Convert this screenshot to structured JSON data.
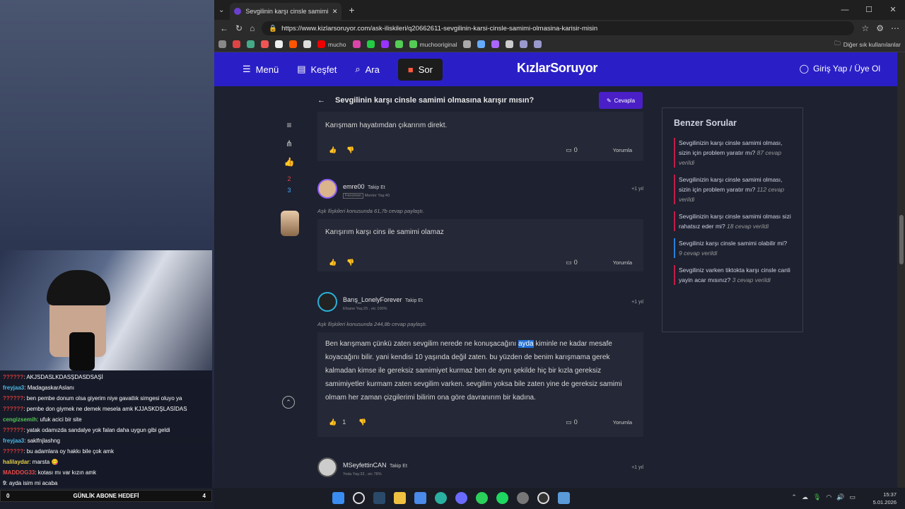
{
  "stream": {
    "chat": [
      {
        "user": "??????",
        "text": ": AKJSDASLKDASŞDASDSAŞİ",
        "color": "#d43a3a"
      },
      {
        "user": "freyjaa3",
        "text": ": MadagaskarAslanı",
        "color": "#4ab8e8"
      },
      {
        "user": "??????",
        "text": ": ben pembe donum olsa giyerim niye gavatlık simgesi oluyo ya",
        "color": "#d43a3a"
      },
      {
        "user": "??????",
        "text": ": pembe don giymek ne demek mesela amk KJJASKDŞLASİDAS",
        "color": "#d43a3a"
      },
      {
        "user": "cengizsemih",
        "text": ": ufuk acici bir site",
        "color": "#56c456"
      },
      {
        "user": "??????",
        "text": ": yatak odamızda sandalye yok falan daha uygun gibi geldi",
        "color": "#d43a3a"
      },
      {
        "user": "freyjaa3",
        "text": ": saklfnjlashng",
        "color": "#4ab8e8"
      },
      {
        "user": "??????",
        "text": ": bu adamlara oy hakkı bile çok amk",
        "color": "#d43a3a"
      },
      {
        "user": "halilaydar",
        "text": ": marsta 😋",
        "color": "#e8d04a"
      },
      {
        "user": "MADDOG33",
        "text": ": kotası mı var kızın amk",
        "color": "#e84a4a"
      },
      {
        "user": "9",
        "text": ": ayda isim mi acaba",
        "color": "#dddddd"
      }
    ],
    "goal_label": "GÜNLİK ABONE HEDEFİ",
    "goal_left": "0",
    "goal_right": "4"
  },
  "browser": {
    "tab_title": "Sevgilinin karşı cinsle samimi olma",
    "url": "https://www.kizlarsoruyor.com/ask-iliskileri/q20662611-sevgilinin-karsi-cinsle-samimi-olmasina-karisir-misin",
    "bookmarks": [
      "mucho",
      "muchooriginal"
    ],
    "bookmark_folder": "Diğer sık kullanılanlar"
  },
  "site": {
    "nav": {
      "menu": "Menü",
      "explore": "Keşfet",
      "search": "Ara",
      "ask": "Sor",
      "logo": "KızlarSoruyor",
      "login": "Giriş Yap / Üye Ol"
    },
    "question_title": "Sevgilinin karşı cinsle samimi olmasına karışır mısın?",
    "reply_button": "Cevapla",
    "side_counts": {
      "down": "2",
      "up": "3"
    },
    "answers": [
      {
        "text": "Karışmam hayatımdan çıkarırım direkt.",
        "comments": "0",
        "comment_label": "Yorumla",
        "likes": ""
      },
      {
        "user": "emre00",
        "follow": "Takip Et",
        "meta_badge": "Fenomen",
        "meta": "Mentor Yaş:40",
        "time": "+1 yıl",
        "topic": "Aşk İlişkileri konusunda 61,7b cevap paylaştı.",
        "text": "Karışırım karşı cins ile samimi olamaz",
        "comments": "0",
        "comment_label": "Yorumla",
        "likes": ""
      },
      {
        "user": "Barış_LonelyForever",
        "follow": "Takip Et",
        "meta": "Efsane Yaş:25 , eic 100%",
        "time": "+1 yıl",
        "topic": "Aşk İlişkileri konusunda 244,8b cevap paylaştı.",
        "text_before": "Ben karışmam çünkü zaten sevgilim nerede ne konuşacağını ",
        "text_highlight": "ayda",
        "text_after": " kiminle ne kadar mesafe koyacağını bilir. yani kendisi 10 yaşında değil zaten. bu yüzden de benim karışmama gerek kalmadan kimse ile gereksiz samimiyet kurmaz ben de aynı şekilde hiç bir kızla gereksiz samimiyetler kurmam zaten sevgilim varken. sevgilim yoksa bile zaten yine de gereksiz samimi olmam her zaman çizgilerimi bilirim ona göre davranırım bir kadına.",
        "likes": "1",
        "comments": "0",
        "comment_label": "Yorumla"
      },
      {
        "user": "MSeyfettinCAN",
        "follow": "Takip Et",
        "meta": "Yoda Yaş:33 , eic 78%",
        "time": "+1 yıl"
      }
    ],
    "similar": {
      "title": "Benzer Sorular",
      "items": [
        {
          "q": "Sevgilinizin karşı cinsle samimi olması, sizin için problem yaratır mı?",
          "count": "87 cevap verildi",
          "color": "red"
        },
        {
          "q": "Sevgilinizin karşı cinsle samimi olması, sizin için problem yaratır mı?",
          "count": "112 cevap verildi",
          "color": "red"
        },
        {
          "q": "Sevgilinizin karşı cinsle samimi olması sizi rahatsız eder mi?",
          "count": "18 cevap verildi",
          "color": "red"
        },
        {
          "q": "Sevgiliniz karşı cinsle samimi olabilir mi?",
          "count": "9 cevap verildi",
          "color": "blue"
        },
        {
          "q": "Sevgiliniz varken tiktokta karşı cinsle canli yayin acar mısınız?",
          "count": "3 cevap verildi",
          "color": "red"
        }
      ]
    }
  },
  "taskbar": {
    "time": "15:37",
    "date": "5.01.2026"
  }
}
